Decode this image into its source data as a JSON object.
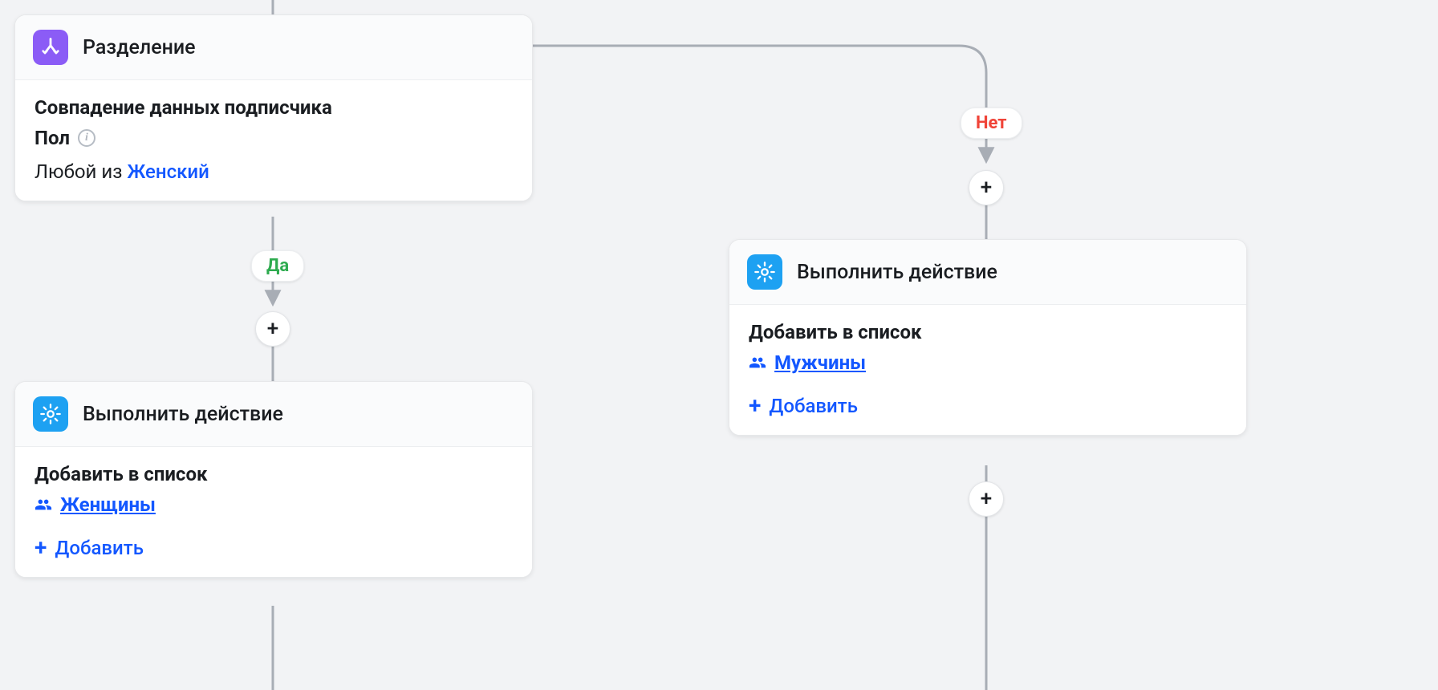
{
  "split": {
    "title": "Разделение",
    "condition_title": "Совпадение данных подписчика",
    "field_label": "Пол",
    "match_prefix": "Любой из ",
    "match_value": "Женский"
  },
  "branch_yes_label": "Да",
  "branch_no_label": "Нет",
  "action_left": {
    "title": "Выполнить действие",
    "subtitle": "Добавить в список",
    "list_name": "Женщины",
    "add_label": "Добавить"
  },
  "action_right": {
    "title": "Выполнить действие",
    "subtitle": "Добавить в список",
    "list_name": "Мужчины",
    "add_label": "Добавить"
  },
  "plus_glyph": "+"
}
